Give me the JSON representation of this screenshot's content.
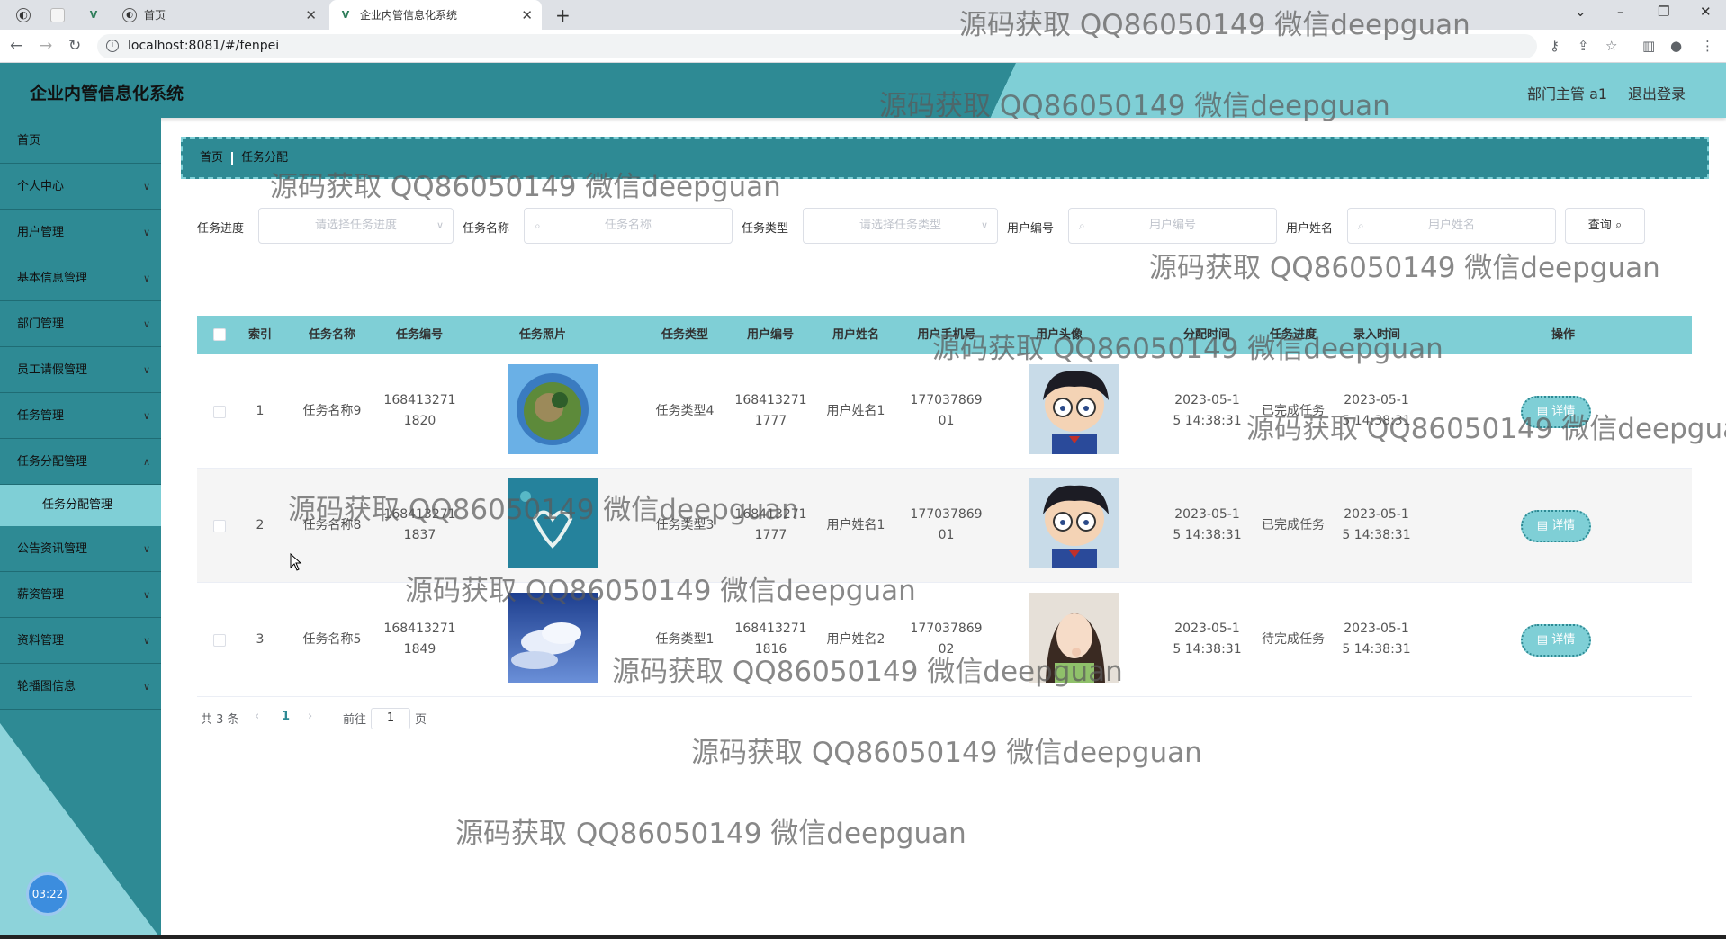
{
  "browser": {
    "tabs": [
      {
        "label": "首页"
      },
      {
        "label": "企业内管信息化系统"
      }
    ],
    "url": "localhost:8081/#/fenpei"
  },
  "header": {
    "title": "企业内管信息化系统",
    "user": "部门主管 a1",
    "logout": "退出登录"
  },
  "sidebar": {
    "items": [
      {
        "label": "首页"
      },
      {
        "label": "个人中心"
      },
      {
        "label": "用户管理"
      },
      {
        "label": "基本信息管理"
      },
      {
        "label": "部门管理"
      },
      {
        "label": "员工请假管理"
      },
      {
        "label": "任务管理"
      },
      {
        "label": "任务分配管理"
      },
      {
        "label": "公告资讯管理"
      },
      {
        "label": "薪资管理"
      },
      {
        "label": "资料管理"
      },
      {
        "label": "轮播图信息"
      }
    ],
    "subitem": "任务分配管理",
    "clock": "03:22"
  },
  "breadcrumb": {
    "home": "首页",
    "current": "任务分配"
  },
  "filters": {
    "progress_label": "任务进度",
    "progress_placeholder": "请选择任务进度",
    "name_label": "任务名称",
    "name_placeholder": "任务名称",
    "type_label": "任务类型",
    "type_placeholder": "请选择任务类型",
    "userno_label": "用户编号",
    "userno_placeholder": "用户编号",
    "username_label": "用户姓名",
    "username_placeholder": "用户姓名",
    "query_button": "查询"
  },
  "table": {
    "headers": [
      "索引",
      "任务名称",
      "任务编号",
      "任务照片",
      "任务类型",
      "用户编号",
      "用户姓名",
      "用户手机号",
      "用户头像",
      "分配时间",
      "任务进度",
      "录入时间",
      "操作"
    ],
    "rows": [
      {
        "index": "1",
        "name": "任务名称9",
        "no1": "168413271",
        "no2": "1820",
        "type": "任务类型4",
        "uno1": "168413271",
        "uno2": "1777",
        "uname": "用户姓名1",
        "phone1": "177037869",
        "phone2": "01",
        "assign1": "2023-05-1",
        "assign2": "5 14:38:31",
        "progress": "已完成任务",
        "entry1": "2023-05-1",
        "entry2": "5 14:38:31",
        "action": "详情"
      },
      {
        "index": "2",
        "name": "任务名称8",
        "no1": "168413271",
        "no2": "1837",
        "type": "任务类型3",
        "uno1": "168413271",
        "uno2": "1777",
        "uname": "用户姓名1",
        "phone1": "177037869",
        "phone2": "01",
        "assign1": "2023-05-1",
        "assign2": "5 14:38:31",
        "progress": "已完成任务",
        "entry1": "2023-05-1",
        "entry2": "5 14:38:31",
        "action": "详情"
      },
      {
        "index": "3",
        "name": "任务名称5",
        "no1": "168413271",
        "no2": "1849",
        "type": "任务类型1",
        "uno1": "168413271",
        "uno2": "1816",
        "uname": "用户姓名2",
        "phone1": "177037869",
        "phone2": "02",
        "assign1": "2023-05-1",
        "assign2": "5 14:38:31",
        "progress": "待完成任务",
        "entry1": "2023-05-1",
        "entry2": "5 14:38:31",
        "action": "详情"
      }
    ]
  },
  "pager": {
    "total": "共 3 条",
    "current": "1",
    "goto": "前往",
    "page_input": "1",
    "page_unit": "页"
  },
  "watermark": "源码获取 QQ86050149 微信deepguan",
  "colors": {
    "primary": "#2e8a94",
    "accent": "#7fcfd6"
  }
}
